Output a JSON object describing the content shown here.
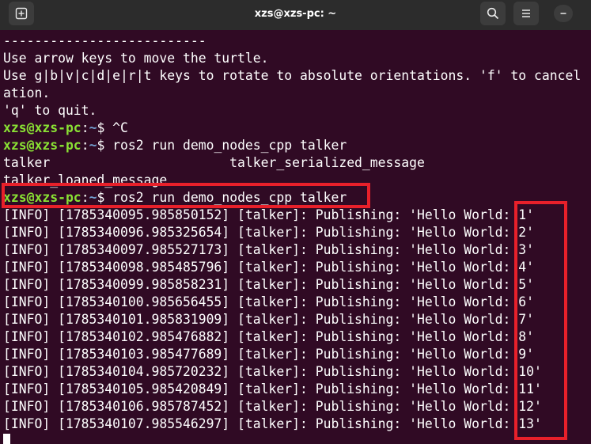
{
  "window": {
    "title": "xzs@xzs-pc: ~",
    "buttons": [
      {
        "name": "new-tab-icon",
        "glyph": "⊞"
      },
      {
        "name": "search-icon",
        "glyph": ""
      },
      {
        "name": "menu-icon",
        "glyph": "≡"
      },
      {
        "name": "minimize-icon",
        "glyph": "–"
      }
    ]
  },
  "colors": {
    "background": "#300a24",
    "prompt_user": "#8ae234",
    "prompt_path": "#729fcf",
    "highlight": "#e8202a"
  },
  "prompt": {
    "user_host": "xzs@xzs-pc",
    "sep": ":",
    "path": "~",
    "dollar": "$"
  },
  "terminal": {
    "header_lines": [
      "--------------------------",
      "Use arrow keys to move the turtle.",
      "Use g|b|v|c|d|e|r|t keys to rotate to absolute orientations. 'f' to cancel",
      "ation.",
      "'q' to quit."
    ],
    "cmd1": " ^C",
    "cmd2": " ros2 run demo_nodes_cpp talker",
    "completion_1": "talker                       talker_serialized_message",
    "completion_2": "talker_loaned_message",
    "cmd3": " ros2 run demo_nodes_cpp talker",
    "log_lines": [
      "[INFO] [1785340095.985850152] [talker]: Publishing: 'Hello World: 1'",
      "[INFO] [1785340096.985325654] [talker]: Publishing: 'Hello World: 2'",
      "[INFO] [1785340097.985527173] [talker]: Publishing: 'Hello World: 3'",
      "[INFO] [1785340098.985485796] [talker]: Publishing: 'Hello World: 4'",
      "[INFO] [1785340099.985858231] [talker]: Publishing: 'Hello World: 5'",
      "[INFO] [1785340100.985656455] [talker]: Publishing: 'Hello World: 6'",
      "[INFO] [1785340101.985831909] [talker]: Publishing: 'Hello World: 7'",
      "[INFO] [1785340102.985476882] [talker]: Publishing: 'Hello World: 8'",
      "[INFO] [1785340103.985477689] [talker]: Publishing: 'Hello World: 9'",
      "[INFO] [1785340104.985720232] [talker]: Publishing: 'Hello World: 10'",
      "[INFO] [1785340105.985420849] [talker]: Publishing: 'Hello World: 11'",
      "[INFO] [1785340106.985787452] [talker]: Publishing: 'Hello World: 12'",
      "[INFO] [1785340107.985546297] [talker]: Publishing: 'Hello World: 13'"
    ]
  }
}
